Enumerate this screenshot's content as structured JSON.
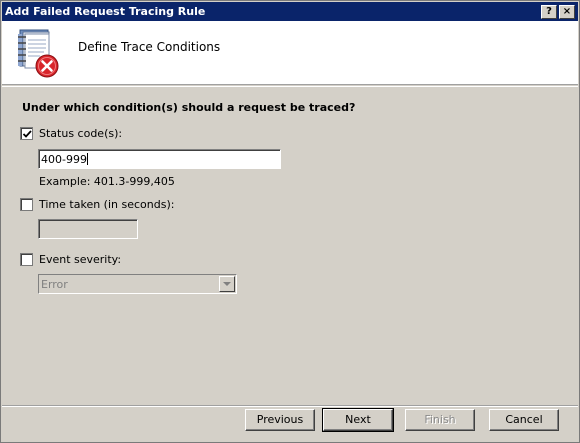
{
  "window": {
    "title": "Add Failed Request Tracing Rule",
    "help_glyph": "?",
    "close_glyph": "×"
  },
  "header": {
    "heading": "Define Trace Conditions",
    "icon": "document-error-icon"
  },
  "form": {
    "question": "Under which condition(s) should a request be traced?",
    "status_code": {
      "label": "Status code(s):",
      "checked": true,
      "value": "400-999",
      "example": "Example: 401.3-999,405"
    },
    "time_taken": {
      "label": "Time taken (in seconds):",
      "checked": false,
      "value": ""
    },
    "event_severity": {
      "label": "Event severity:",
      "checked": false,
      "selected": "Error"
    }
  },
  "buttons": {
    "previous": "Previous",
    "next": "Next",
    "finish": "Finish",
    "cancel": "Cancel"
  },
  "colors": {
    "titlebar": "#0a246a",
    "face": "#d4d0c8",
    "error_red": "#d8252a"
  }
}
